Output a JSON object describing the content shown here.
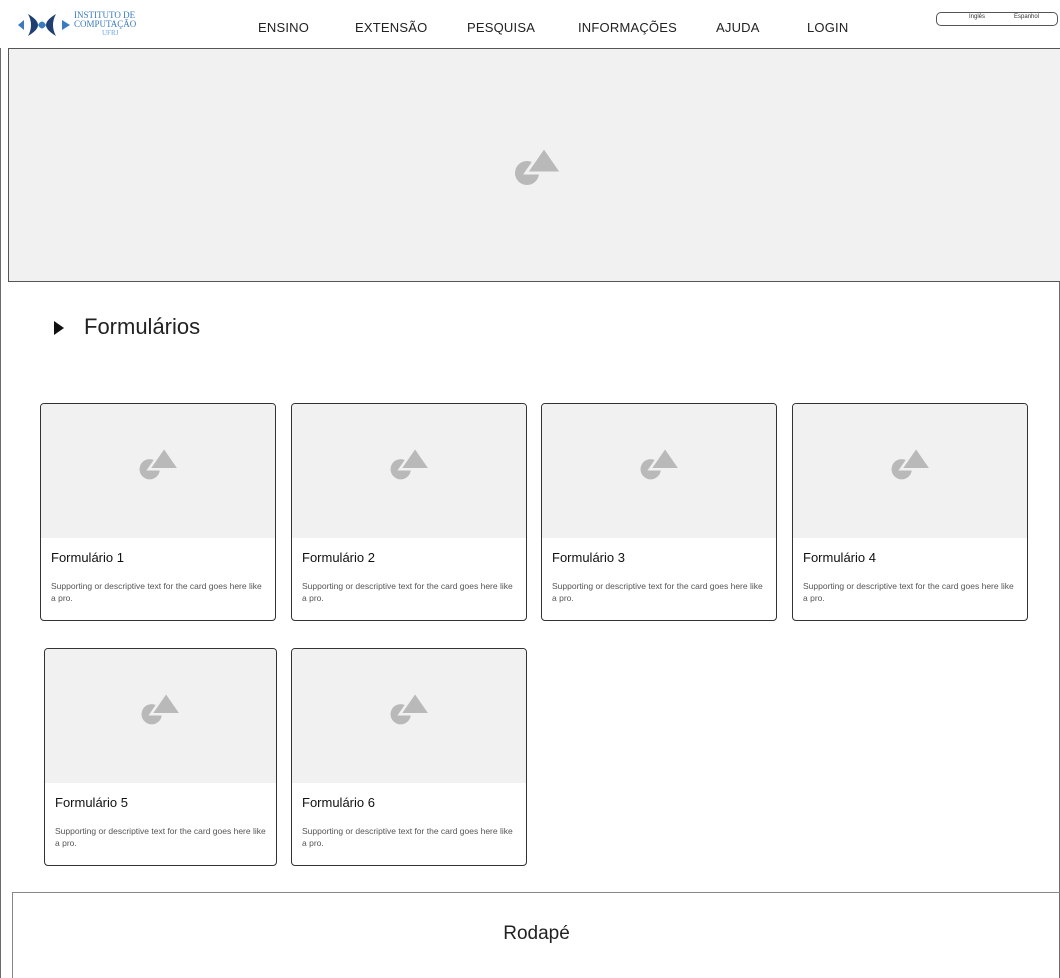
{
  "brand": {
    "line1": "INSTITUTO DE",
    "line2": "COMPUTAÇÃO",
    "line3": "UFRJ",
    "colors": {
      "primary": "#3a7bbf",
      "light": "#6ea6d8"
    }
  },
  "nav": {
    "items": [
      "ENSINO",
      "EXTENSÃO",
      "PESQUISA",
      "INFORMAÇÕES",
      "AJUDA",
      "LOGIN"
    ]
  },
  "language": {
    "options": [
      "Inglês",
      "Espanhol"
    ]
  },
  "hero": {
    "icon": "image-placeholder-icon"
  },
  "section": {
    "title": "Formulários"
  },
  "cards": [
    {
      "title": "Formulário 1",
      "description": "Supporting or descriptive text for the card goes here like a pro."
    },
    {
      "title": "Formulário 2",
      "description": "Supporting or descriptive text for the card goes here like a pro."
    },
    {
      "title": "Formulário 3",
      "description": "Supporting or descriptive text for the card goes here like a pro."
    },
    {
      "title": "Formulário 4",
      "description": "Supporting or descriptive text for the card goes here like a pro."
    },
    {
      "title": "Formulário 5",
      "description": "Supporting or descriptive text for the card goes here like a pro."
    },
    {
      "title": "Formulário 6",
      "description": "Supporting or descriptive text for the card goes here like a pro."
    }
  ],
  "footer": {
    "text": "Rodapé"
  }
}
